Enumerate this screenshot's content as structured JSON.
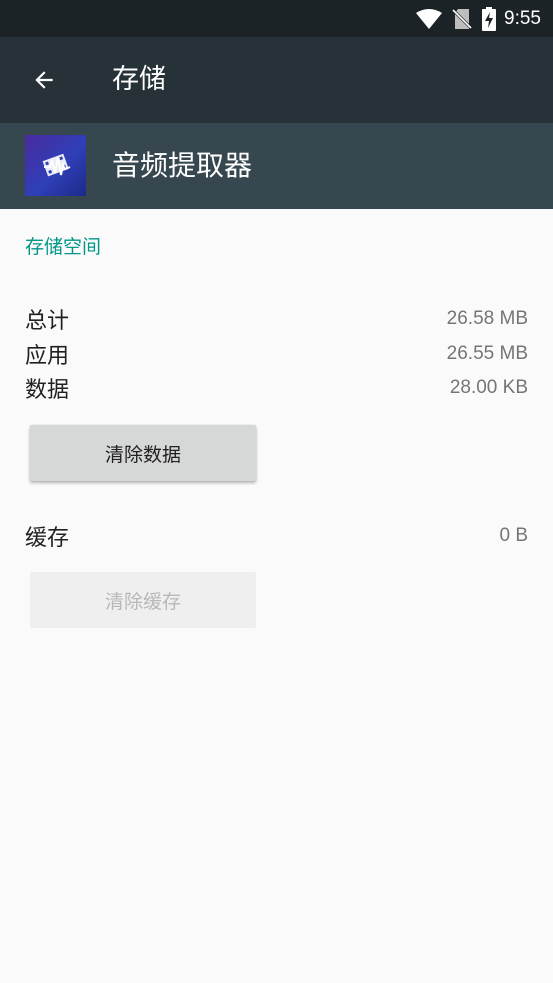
{
  "status_bar": {
    "time": "9:55",
    "icons": [
      "wifi-icon",
      "no-sim-icon",
      "battery-charging-icon"
    ]
  },
  "toolbar": {
    "title": "存储",
    "back_icon": "arrow-back-icon"
  },
  "app": {
    "name": "音频提取器",
    "icon": "audio-extractor-app-icon"
  },
  "storage": {
    "section_title": "存储空间",
    "rows": [
      {
        "label": "总计",
        "value": "26.58 MB"
      },
      {
        "label": "应用",
        "value": "26.55 MB"
      },
      {
        "label": "数据",
        "value": "28.00 KB"
      }
    ],
    "clear_data_label": "清除数据",
    "cache": {
      "label": "缓存",
      "value": "0 B"
    },
    "clear_cache_label": "清除缓存"
  },
  "colors": {
    "status_bar": "#1b2327",
    "toolbar": "#263238",
    "app_header": "#37474f",
    "accent": "#009688",
    "background": "#fafafa"
  }
}
